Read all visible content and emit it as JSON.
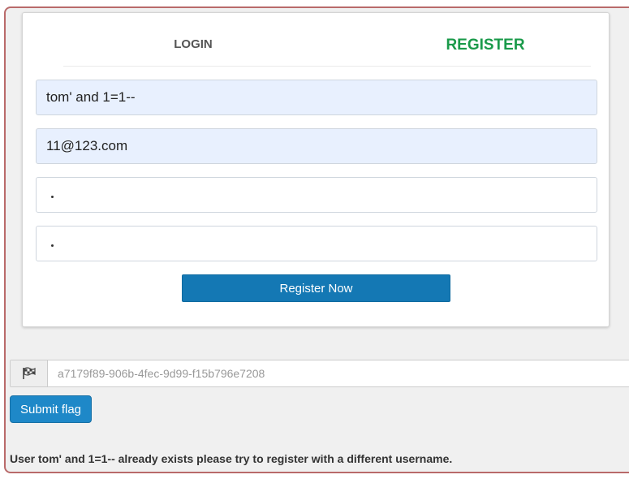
{
  "tabs": {
    "login": "LOGIN",
    "register": "REGISTER"
  },
  "form": {
    "username_value": "tom' and 1=1--",
    "email_value": "11@123.com",
    "password_value": "•",
    "confirm_password_value": "•",
    "submit_label": "Register Now"
  },
  "flag": {
    "icon": "flag-checkered-icon",
    "input_value": "a7179f89-906b-4fec-9d99-f15b796e7208",
    "submit_label": "Submit flag"
  },
  "status": {
    "message": "User tom' and 1=1-- already exists please try to register with a different username."
  },
  "colors": {
    "accent_green": "#1a9a4a",
    "button_blue": "#1478b4",
    "submit_blue": "#1e88c8",
    "frame_border": "#b96a6a",
    "autofill_bg": "#e8f0fe"
  }
}
